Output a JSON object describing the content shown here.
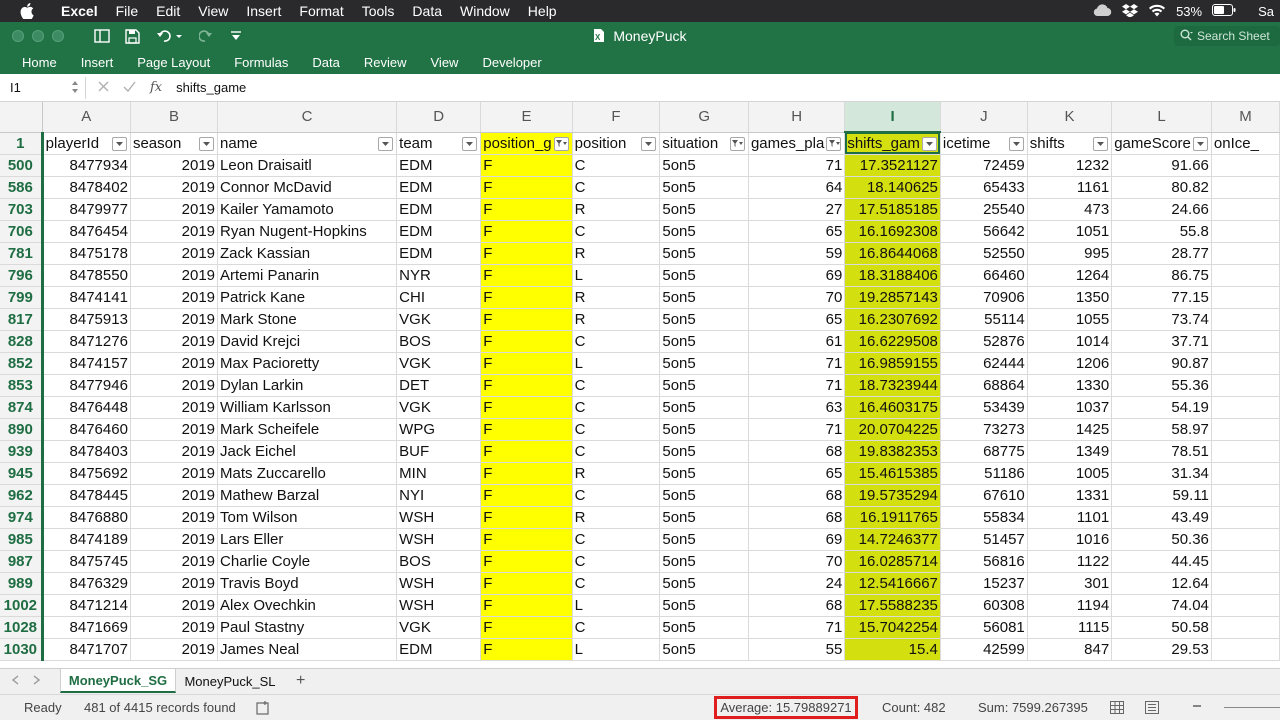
{
  "mac_menu": {
    "app": "Excel",
    "items": [
      "File",
      "Edit",
      "View",
      "Insert",
      "Format",
      "Tools",
      "Data",
      "Window",
      "Help"
    ],
    "battery": "53%",
    "user_initial": "Sa"
  },
  "window": {
    "title": "MoneyPuck",
    "search_placeholder": "Search Sheet"
  },
  "ribbon": {
    "tabs": [
      "Home",
      "Insert",
      "Page Layout",
      "Formulas",
      "Data",
      "Review",
      "View",
      "Developer"
    ]
  },
  "formula_bar": {
    "cell_ref": "I1",
    "fx": "fx",
    "content": "shifts_game"
  },
  "grid": {
    "columns": [
      "A",
      "B",
      "C",
      "D",
      "E",
      "F",
      "G",
      "H",
      "I",
      "J",
      "K",
      "L",
      "M"
    ],
    "selected_column": "I",
    "header_row_number": "1",
    "headers": [
      "playerId",
      "season",
      "name",
      "team",
      "position_g",
      "position",
      "situation",
      "games_pla",
      "shifts_gam",
      "icetime",
      "shifts",
      "gameScore",
      "onIce_"
    ],
    "rows": [
      {
        "num": "500",
        "cells": [
          "8477934",
          "2019",
          "Leon Draisaitl",
          "EDM",
          "F",
          "C",
          "5on5",
          "71",
          "17.3521127",
          "72459",
          "1232",
          "91.66"
        ]
      },
      {
        "num": "586",
        "cells": [
          "8478402",
          "2019",
          "Connor McDavid",
          "EDM",
          "F",
          "C",
          "5on5",
          "64",
          "18.140625",
          "65433",
          "1161",
          "80.82"
        ]
      },
      {
        "num": "703",
        "cells": [
          "8479977",
          "2019",
          "Kailer Yamamoto",
          "EDM",
          "F",
          "R",
          "5on5",
          "27",
          "17.5185185",
          "25540",
          "473",
          "24.66"
        ]
      },
      {
        "num": "706",
        "cells": [
          "8476454",
          "2019",
          "Ryan Nugent-Hopkins",
          "EDM",
          "F",
          "C",
          "5on5",
          "65",
          "16.1692308",
          "56642",
          "1051",
          "55.8"
        ]
      },
      {
        "num": "781",
        "cells": [
          "8475178",
          "2019",
          "Zack Kassian",
          "EDM",
          "F",
          "R",
          "5on5",
          "59",
          "16.8644068",
          "52550",
          "995",
          "28.77"
        ]
      },
      {
        "num": "796",
        "cells": [
          "8478550",
          "2019",
          "Artemi Panarin",
          "NYR",
          "F",
          "L",
          "5on5",
          "69",
          "18.3188406",
          "66460",
          "1264",
          "86.75"
        ]
      },
      {
        "num": "799",
        "cells": [
          "8474141",
          "2019",
          "Patrick Kane",
          "CHI",
          "F",
          "R",
          "5on5",
          "70",
          "19.2857143",
          "70906",
          "1350",
          "77.15"
        ]
      },
      {
        "num": "817",
        "cells": [
          "8475913",
          "2019",
          "Mark Stone",
          "VGK",
          "F",
          "R",
          "5on5",
          "65",
          "16.2307692",
          "55114",
          "1055",
          "73.74"
        ]
      },
      {
        "num": "828",
        "cells": [
          "8471276",
          "2019",
          "David Krejci",
          "BOS",
          "F",
          "C",
          "5on5",
          "61",
          "16.6229508",
          "52876",
          "1014",
          "37.71"
        ]
      },
      {
        "num": "852",
        "cells": [
          "8474157",
          "2019",
          "Max Pacioretty",
          "VGK",
          "F",
          "L",
          "5on5",
          "71",
          "16.9859155",
          "62444",
          "1206",
          "90.87"
        ]
      },
      {
        "num": "853",
        "cells": [
          "8477946",
          "2019",
          "Dylan Larkin",
          "DET",
          "F",
          "C",
          "5on5",
          "71",
          "18.7323944",
          "68864",
          "1330",
          "55.36"
        ]
      },
      {
        "num": "874",
        "cells": [
          "8476448",
          "2019",
          "William Karlsson",
          "VGK",
          "F",
          "C",
          "5on5",
          "63",
          "16.4603175",
          "53439",
          "1037",
          "54.19"
        ]
      },
      {
        "num": "890",
        "cells": [
          "8476460",
          "2019",
          "Mark Scheifele",
          "WPG",
          "F",
          "C",
          "5on5",
          "71",
          "20.0704225",
          "73273",
          "1425",
          "58.97"
        ]
      },
      {
        "num": "939",
        "cells": [
          "8478403",
          "2019",
          "Jack Eichel",
          "BUF",
          "F",
          "C",
          "5on5",
          "68",
          "19.8382353",
          "68775",
          "1349",
          "78.51"
        ]
      },
      {
        "num": "945",
        "cells": [
          "8475692",
          "2019",
          "Mats Zuccarello",
          "MIN",
          "F",
          "R",
          "5on5",
          "65",
          "15.4615385",
          "51186",
          "1005",
          "31.34"
        ]
      },
      {
        "num": "962",
        "cells": [
          "8478445",
          "2019",
          "Mathew Barzal",
          "NYI",
          "F",
          "C",
          "5on5",
          "68",
          "19.5735294",
          "67610",
          "1331",
          "59.11"
        ]
      },
      {
        "num": "974",
        "cells": [
          "8476880",
          "2019",
          "Tom Wilson",
          "WSH",
          "F",
          "R",
          "5on5",
          "68",
          "16.1911765",
          "55834",
          "1101",
          "43.49"
        ]
      },
      {
        "num": "985",
        "cells": [
          "8474189",
          "2019",
          "Lars Eller",
          "WSH",
          "F",
          "C",
          "5on5",
          "69",
          "14.7246377",
          "51457",
          "1016",
          "50.36"
        ]
      },
      {
        "num": "987",
        "cells": [
          "8475745",
          "2019",
          "Charlie Coyle",
          "BOS",
          "F",
          "C",
          "5on5",
          "70",
          "16.0285714",
          "56816",
          "1122",
          "44.45"
        ]
      },
      {
        "num": "989",
        "cells": [
          "8476329",
          "2019",
          "Travis Boyd",
          "WSH",
          "F",
          "C",
          "5on5",
          "24",
          "12.5416667",
          "15237",
          "301",
          "12.64"
        ]
      },
      {
        "num": "1002",
        "cells": [
          "8471214",
          "2019",
          "Alex Ovechkin",
          "WSH",
          "F",
          "L",
          "5on5",
          "68",
          "17.5588235",
          "60308",
          "1194",
          "74.04"
        ]
      },
      {
        "num": "1028",
        "cells": [
          "8471669",
          "2019",
          "Paul Stastny",
          "VGK",
          "F",
          "C",
          "5on5",
          "71",
          "15.7042254",
          "56081",
          "1115",
          "50.58"
        ]
      },
      {
        "num": "1030",
        "cells": [
          "8471707",
          "2019",
          "James Neal",
          "EDM",
          "F",
          "L",
          "5on5",
          "55",
          "15.4",
          "42599",
          "847",
          "29.53"
        ]
      }
    ]
  },
  "sheets": [
    "MoneyPuck_SG",
    "MoneyPuck_SL"
  ],
  "status": {
    "mode": "Ready",
    "records": "481 of 4415 records found",
    "average": "Average: 15.79889271",
    "count": "Count: 482",
    "sum": "Sum: 7599.267395"
  }
}
